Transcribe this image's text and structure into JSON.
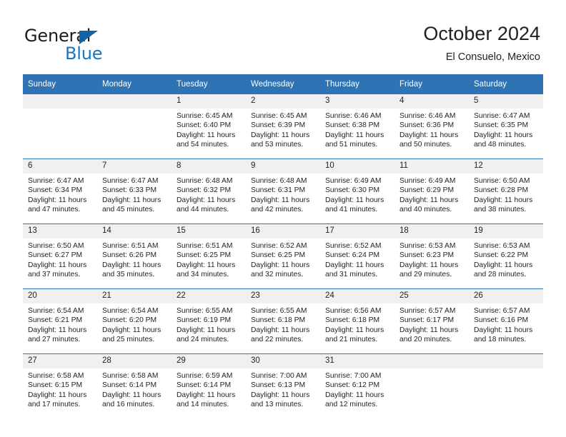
{
  "brand": {
    "word_general": "General",
    "word_blue": "Blue",
    "triangle_color": "#1464a5",
    "blue_color": "#1675c6"
  },
  "header": {
    "title": "October 2024",
    "subtitle": "El Consuelo, Mexico"
  },
  "theme": {
    "header_blue": "#2e74b5",
    "daynum_gray": "#f0f0f0",
    "text": "#231f20"
  },
  "calendar": {
    "weekday_headers": [
      "Sunday",
      "Monday",
      "Tuesday",
      "Wednesday",
      "Thursday",
      "Friday",
      "Saturday"
    ],
    "labels": {
      "sunrise_prefix": "Sunrise:",
      "sunset_prefix": "Sunset:",
      "daylight_prefix": "Daylight:"
    },
    "weeks": [
      [
        {
          "day": "",
          "sunrise": "",
          "sunset": "",
          "daylight": ""
        },
        {
          "day": "",
          "sunrise": "",
          "sunset": "",
          "daylight": ""
        },
        {
          "day": "1",
          "sunrise": "Sunrise: 6:45 AM",
          "sunset": "Sunset: 6:40 PM",
          "daylight": "Daylight: 11 hours and 54 minutes."
        },
        {
          "day": "2",
          "sunrise": "Sunrise: 6:45 AM",
          "sunset": "Sunset: 6:39 PM",
          "daylight": "Daylight: 11 hours and 53 minutes."
        },
        {
          "day": "3",
          "sunrise": "Sunrise: 6:46 AM",
          "sunset": "Sunset: 6:38 PM",
          "daylight": "Daylight: 11 hours and 51 minutes."
        },
        {
          "day": "4",
          "sunrise": "Sunrise: 6:46 AM",
          "sunset": "Sunset: 6:36 PM",
          "daylight": "Daylight: 11 hours and 50 minutes."
        },
        {
          "day": "5",
          "sunrise": "Sunrise: 6:47 AM",
          "sunset": "Sunset: 6:35 PM",
          "daylight": "Daylight: 11 hours and 48 minutes."
        }
      ],
      [
        {
          "day": "6",
          "sunrise": "Sunrise: 6:47 AM",
          "sunset": "Sunset: 6:34 PM",
          "daylight": "Daylight: 11 hours and 47 minutes."
        },
        {
          "day": "7",
          "sunrise": "Sunrise: 6:47 AM",
          "sunset": "Sunset: 6:33 PM",
          "daylight": "Daylight: 11 hours and 45 minutes."
        },
        {
          "day": "8",
          "sunrise": "Sunrise: 6:48 AM",
          "sunset": "Sunset: 6:32 PM",
          "daylight": "Daylight: 11 hours and 44 minutes."
        },
        {
          "day": "9",
          "sunrise": "Sunrise: 6:48 AM",
          "sunset": "Sunset: 6:31 PM",
          "daylight": "Daylight: 11 hours and 42 minutes."
        },
        {
          "day": "10",
          "sunrise": "Sunrise: 6:49 AM",
          "sunset": "Sunset: 6:30 PM",
          "daylight": "Daylight: 11 hours and 41 minutes."
        },
        {
          "day": "11",
          "sunrise": "Sunrise: 6:49 AM",
          "sunset": "Sunset: 6:29 PM",
          "daylight": "Daylight: 11 hours and 40 minutes."
        },
        {
          "day": "12",
          "sunrise": "Sunrise: 6:50 AM",
          "sunset": "Sunset: 6:28 PM",
          "daylight": "Daylight: 11 hours and 38 minutes."
        }
      ],
      [
        {
          "day": "13",
          "sunrise": "Sunrise: 6:50 AM",
          "sunset": "Sunset: 6:27 PM",
          "daylight": "Daylight: 11 hours and 37 minutes."
        },
        {
          "day": "14",
          "sunrise": "Sunrise: 6:51 AM",
          "sunset": "Sunset: 6:26 PM",
          "daylight": "Daylight: 11 hours and 35 minutes."
        },
        {
          "day": "15",
          "sunrise": "Sunrise: 6:51 AM",
          "sunset": "Sunset: 6:25 PM",
          "daylight": "Daylight: 11 hours and 34 minutes."
        },
        {
          "day": "16",
          "sunrise": "Sunrise: 6:52 AM",
          "sunset": "Sunset: 6:25 PM",
          "daylight": "Daylight: 11 hours and 32 minutes."
        },
        {
          "day": "17",
          "sunrise": "Sunrise: 6:52 AM",
          "sunset": "Sunset: 6:24 PM",
          "daylight": "Daylight: 11 hours and 31 minutes."
        },
        {
          "day": "18",
          "sunrise": "Sunrise: 6:53 AM",
          "sunset": "Sunset: 6:23 PM",
          "daylight": "Daylight: 11 hours and 29 minutes."
        },
        {
          "day": "19",
          "sunrise": "Sunrise: 6:53 AM",
          "sunset": "Sunset: 6:22 PM",
          "daylight": "Daylight: 11 hours and 28 minutes."
        }
      ],
      [
        {
          "day": "20",
          "sunrise": "Sunrise: 6:54 AM",
          "sunset": "Sunset: 6:21 PM",
          "daylight": "Daylight: 11 hours and 27 minutes."
        },
        {
          "day": "21",
          "sunrise": "Sunrise: 6:54 AM",
          "sunset": "Sunset: 6:20 PM",
          "daylight": "Daylight: 11 hours and 25 minutes."
        },
        {
          "day": "22",
          "sunrise": "Sunrise: 6:55 AM",
          "sunset": "Sunset: 6:19 PM",
          "daylight": "Daylight: 11 hours and 24 minutes."
        },
        {
          "day": "23",
          "sunrise": "Sunrise: 6:55 AM",
          "sunset": "Sunset: 6:18 PM",
          "daylight": "Daylight: 11 hours and 22 minutes."
        },
        {
          "day": "24",
          "sunrise": "Sunrise: 6:56 AM",
          "sunset": "Sunset: 6:18 PM",
          "daylight": "Daylight: 11 hours and 21 minutes."
        },
        {
          "day": "25",
          "sunrise": "Sunrise: 6:57 AM",
          "sunset": "Sunset: 6:17 PM",
          "daylight": "Daylight: 11 hours and 20 minutes."
        },
        {
          "day": "26",
          "sunrise": "Sunrise: 6:57 AM",
          "sunset": "Sunset: 6:16 PM",
          "daylight": "Daylight: 11 hours and 18 minutes."
        }
      ],
      [
        {
          "day": "27",
          "sunrise": "Sunrise: 6:58 AM",
          "sunset": "Sunset: 6:15 PM",
          "daylight": "Daylight: 11 hours and 17 minutes."
        },
        {
          "day": "28",
          "sunrise": "Sunrise: 6:58 AM",
          "sunset": "Sunset: 6:14 PM",
          "daylight": "Daylight: 11 hours and 16 minutes."
        },
        {
          "day": "29",
          "sunrise": "Sunrise: 6:59 AM",
          "sunset": "Sunset: 6:14 PM",
          "daylight": "Daylight: 11 hours and 14 minutes."
        },
        {
          "day": "30",
          "sunrise": "Sunrise: 7:00 AM",
          "sunset": "Sunset: 6:13 PM",
          "daylight": "Daylight: 11 hours and 13 minutes."
        },
        {
          "day": "31",
          "sunrise": "Sunrise: 7:00 AM",
          "sunset": "Sunset: 6:12 PM",
          "daylight": "Daylight: 11 hours and 12 minutes."
        },
        {
          "day": "",
          "sunrise": "",
          "sunset": "",
          "daylight": ""
        },
        {
          "day": "",
          "sunrise": "",
          "sunset": "",
          "daylight": ""
        }
      ]
    ]
  }
}
